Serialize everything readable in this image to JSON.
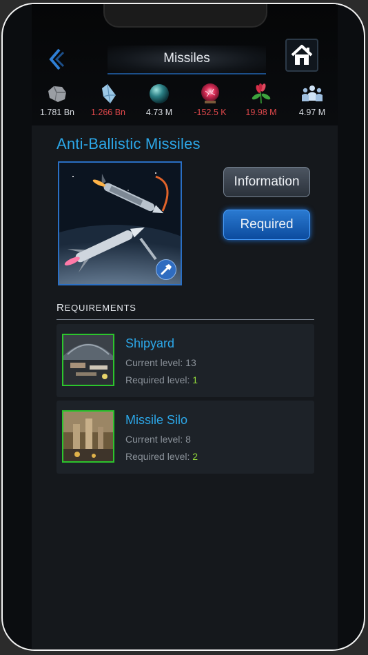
{
  "header": {
    "title": "Missiles",
    "back_icon": "chevron-left-icon",
    "home_icon": "home-icon"
  },
  "resources": [
    {
      "name": "metal",
      "icon": "rock-icon",
      "value": "1.781 Bn",
      "negative": false
    },
    {
      "name": "crystal",
      "icon": "crystal-icon",
      "value": "1.266 Bn",
      "negative": true
    },
    {
      "name": "deuterium",
      "icon": "sphere-icon",
      "value": "4.73 M",
      "negative": false
    },
    {
      "name": "energy",
      "icon": "plasma-orb-icon",
      "value": "-152.5 K",
      "negative": true
    },
    {
      "name": "food",
      "icon": "plant-icon",
      "value": "19.98 M",
      "negative": true
    },
    {
      "name": "population",
      "icon": "people-icon",
      "value": "4.97 M",
      "negative": false
    }
  ],
  "item": {
    "title": "Anti-Ballistic Missiles",
    "info_button": "Information",
    "required_button": "Required"
  },
  "requirements": {
    "heading_first": "R",
    "heading_rest": "EQUIREMENTS",
    "current_label": "Current level: ",
    "required_label": "Required level: ",
    "items": [
      {
        "name": "Shipyard",
        "current": "13",
        "required": "1"
      },
      {
        "name": "Missile Silo",
        "current": "8",
        "required": "2"
      }
    ]
  },
  "colors": {
    "accent": "#2ca7e8",
    "negative": "#e0484b",
    "met": "#8fd43a",
    "button_blue": "#1f6fd0"
  }
}
